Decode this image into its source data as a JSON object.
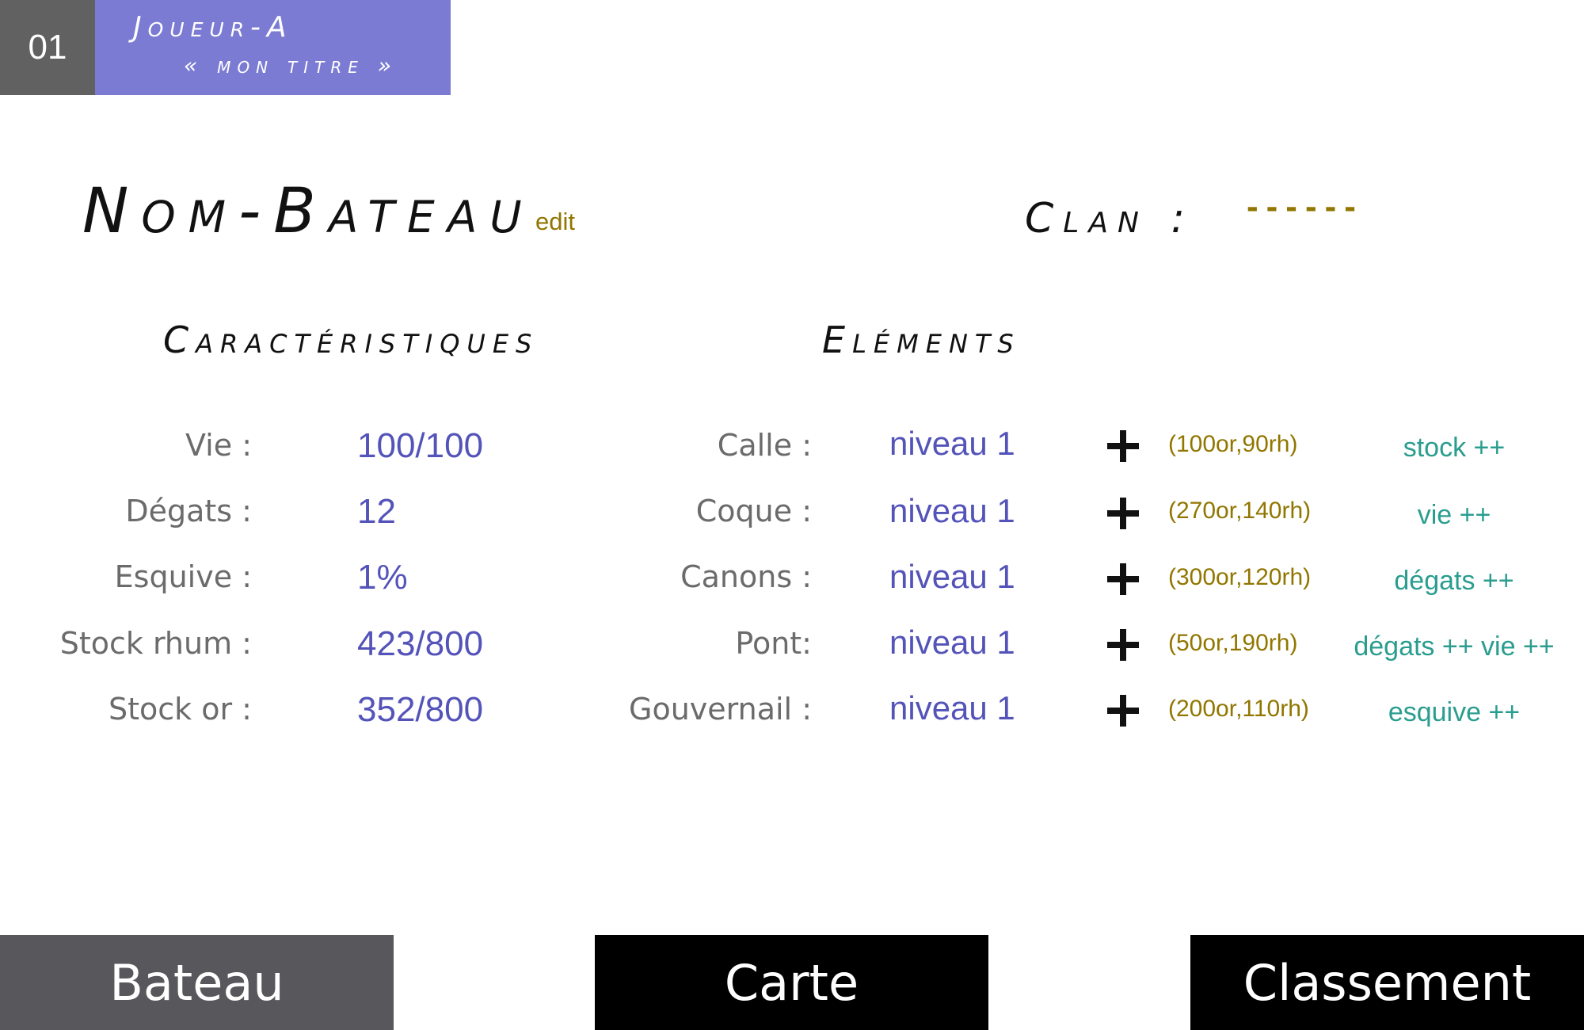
{
  "player": {
    "number": "01",
    "name": "Joueur-A",
    "title": "« mon titre »"
  },
  "ship": {
    "name": "Nom-Bateau",
    "edit_label": "edit"
  },
  "clan": {
    "label": "Clan :",
    "value": "------"
  },
  "characteristics": {
    "heading": "Caractéristiques",
    "rows": [
      {
        "label": "Vie :",
        "value": "100/100"
      },
      {
        "label": "Dégats :",
        "value": "12"
      },
      {
        "label": "Esquive :",
        "value": "1%"
      },
      {
        "label": "Stock rhum :",
        "value": "423/800"
      },
      {
        "label": "Stock or :",
        "value": "352/800"
      }
    ]
  },
  "elements": {
    "heading": "Eléments",
    "rows": [
      {
        "label": "Calle :",
        "level": "niveau 1",
        "cost": "(100or,90rh)",
        "effect": "stock ++"
      },
      {
        "label": "Coque :",
        "level": "niveau 1",
        "cost": "(270or,140rh)",
        "effect": "vie ++"
      },
      {
        "label": "Canons :",
        "level": "niveau 1",
        "cost": "(300or,120rh)",
        "effect": "dégats ++"
      },
      {
        "label": "Pont:",
        "level": "niveau 1",
        "cost": "(50or,190rh)",
        "effect": "dégats ++ vie ++"
      },
      {
        "label": "Gouvernail :",
        "level": "niveau 1",
        "cost": "(200or,110rh)",
        "effect": "esquive ++"
      }
    ]
  },
  "nav": {
    "tabs": [
      {
        "label": "Bateau",
        "active": true
      },
      {
        "label": "Carte",
        "active": false
      },
      {
        "label": "Classement",
        "active": false
      }
    ]
  },
  "colors": {
    "player_box": "#7b7bd4",
    "number_box": "#616161",
    "value_blue": "#5353b9",
    "cost_gold": "#917600",
    "effect_teal": "#2a9d8f",
    "nav_active": "#57575c",
    "nav_inactive": "#000000"
  },
  "icons": {
    "upgrade": "plus-icon"
  }
}
